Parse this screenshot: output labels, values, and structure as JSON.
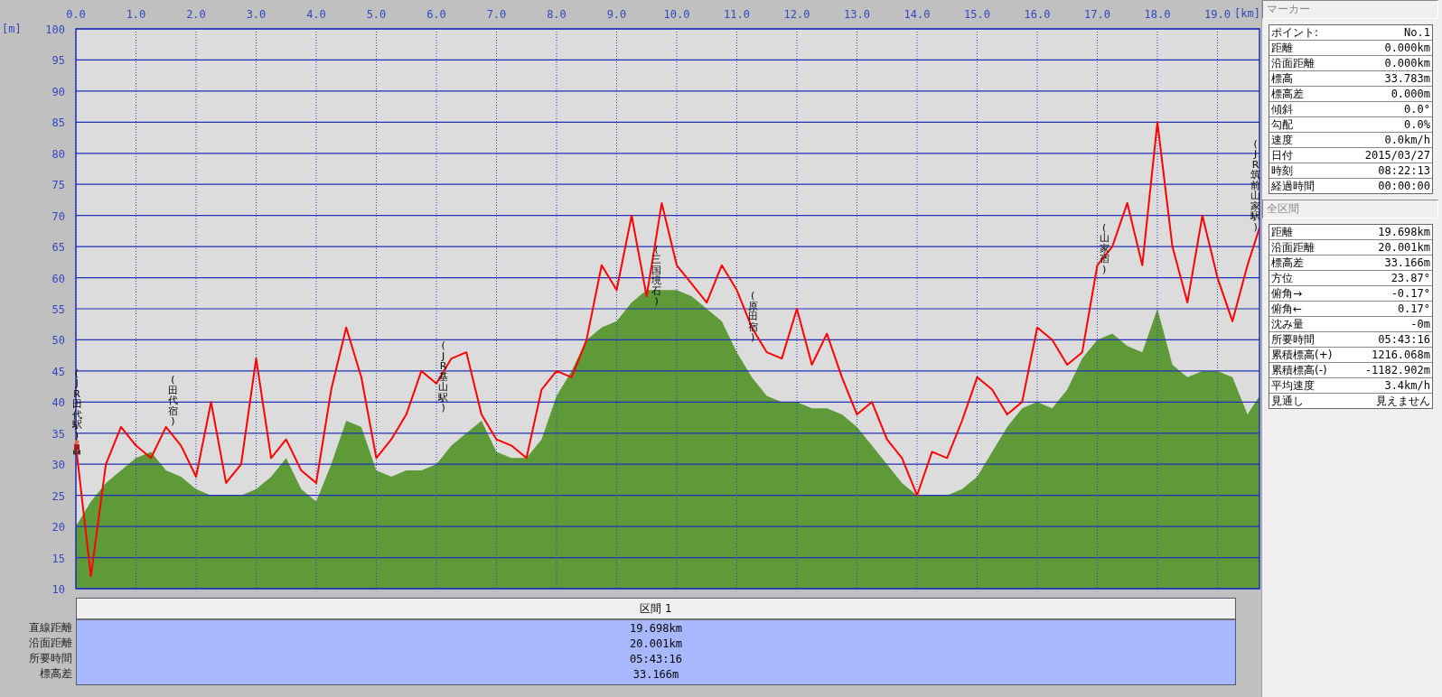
{
  "chart": {
    "chart_data": {
      "type": "area",
      "xlabel": "[km]",
      "ylabel": "[m]",
      "grid": true,
      "xlim": [
        0,
        19.7
      ],
      "ylim": [
        10,
        100
      ],
      "xticks": [
        {
          "value": 0,
          "label": "0.0"
        },
        {
          "value": 1,
          "label": "1.0"
        },
        {
          "value": 2,
          "label": "2.0"
        },
        {
          "value": 3,
          "label": "3.0"
        },
        {
          "value": 4,
          "label": "4.0"
        },
        {
          "value": 5,
          "label": "5.0"
        },
        {
          "value": 6,
          "label": "6.0"
        },
        {
          "value": 7,
          "label": "7.0"
        },
        {
          "value": 8,
          "label": "8.0"
        },
        {
          "value": 9,
          "label": "9.0"
        },
        {
          "value": 10,
          "label": "10.0"
        },
        {
          "value": 11,
          "label": "11.0"
        },
        {
          "value": 12,
          "label": "12.0"
        },
        {
          "value": 13,
          "label": "13.0"
        },
        {
          "value": 14,
          "label": "14.0"
        },
        {
          "value": 15,
          "label": "15.0"
        },
        {
          "value": 16,
          "label": "16.0"
        },
        {
          "value": 17,
          "label": "17.0"
        },
        {
          "value": 18,
          "label": "18.0"
        },
        {
          "value": 19,
          "label": "19.0"
        }
      ],
      "yticks": [
        10,
        15,
        20,
        25,
        30,
        35,
        40,
        45,
        50,
        55,
        60,
        65,
        70,
        75,
        80,
        85,
        90,
        95,
        100
      ],
      "x": [
        0,
        0.25,
        0.5,
        0.75,
        1,
        1.25,
        1.5,
        1.75,
        2,
        2.25,
        2.5,
        2.75,
        3,
        3.25,
        3.5,
        3.75,
        4,
        4.25,
        4.5,
        4.75,
        5,
        5.25,
        5.5,
        5.75,
        6,
        6.25,
        6.5,
        6.75,
        7,
        7.25,
        7.5,
        7.75,
        8,
        8.25,
        8.5,
        8.75,
        9,
        9.25,
        9.5,
        9.75,
        10,
        10.25,
        10.5,
        10.75,
        11,
        11.25,
        11.5,
        11.75,
        12,
        12.25,
        12.5,
        12.75,
        13,
        13.25,
        13.5,
        13.75,
        14,
        14.25,
        14.5,
        14.75,
        15,
        15.25,
        15.5,
        15.75,
        16,
        16.25,
        16.5,
        16.75,
        17,
        17.25,
        17.5,
        17.75,
        18,
        18.25,
        18.5,
        18.75,
        19,
        19.25,
        19.5,
        19.7
      ],
      "series": [
        {
          "type": "area",
          "color": "#5f9a38",
          "values": [
            20,
            24,
            27,
            29,
            31,
            32,
            29,
            28,
            26,
            25,
            25,
            25,
            26,
            28,
            31,
            26,
            24,
            30,
            37,
            36,
            29,
            28,
            29,
            29,
            30,
            33,
            35,
            37,
            32,
            31,
            31,
            34,
            41,
            45,
            50,
            52,
            53,
            56,
            58,
            58,
            58,
            57,
            55,
            53,
            48,
            44,
            41,
            40,
            40,
            39,
            39,
            38,
            36,
            33,
            30,
            27,
            25,
            25,
            25,
            26,
            28,
            32,
            36,
            39,
            40,
            39,
            42,
            47,
            50,
            51,
            49,
            48,
            55,
            46,
            44,
            45,
            45,
            44,
            38,
            41
          ]
        },
        {
          "type": "line",
          "color": "#ff0000",
          "values": [
            33,
            12,
            30,
            36,
            33,
            31,
            36,
            33,
            28,
            40,
            27,
            30,
            47,
            31,
            34,
            29,
            27,
            42,
            52,
            44,
            31,
            34,
            38,
            45,
            43,
            47,
            48,
            38,
            34,
            33,
            31,
            42,
            45,
            44,
            50,
            62,
            58,
            70,
            57,
            72,
            62,
            59,
            56,
            62,
            58,
            52,
            48,
            47,
            55,
            46,
            51,
            44,
            38,
            40,
            34,
            31,
            25,
            32,
            31,
            37,
            44,
            42,
            38,
            40,
            52,
            50,
            46,
            48,
            62,
            65,
            72,
            62,
            85,
            65,
            56,
            70,
            60,
            53,
            62,
            68
          ]
        }
      ],
      "annotations": [
        "(JR田代駅)",
        "(田代宿)",
        "(JR基山駅)",
        "(三国境石)",
        "(原田宿)",
        "(山家宿)",
        "(JR筑前山家駅)"
      ]
    }
  },
  "section_table": {
    "header": "区間 1",
    "rows": [
      {
        "label": "直線距離",
        "value": "19.698km"
      },
      {
        "label": "沿面距離",
        "value": "20.001km"
      },
      {
        "label": "所要時間",
        "value": "05:43:16"
      },
      {
        "label": "標高差",
        "value": "33.166m"
      }
    ]
  },
  "marker_panel": {
    "title": "マーカー",
    "rows": [
      {
        "label": "ポイント:",
        "value": "No.1"
      },
      {
        "label": "距離",
        "value": "0.000km"
      },
      {
        "label": "沿面距離",
        "value": "0.000km"
      },
      {
        "label": "標高",
        "value": "33.783m"
      },
      {
        "label": "標高差",
        "value": "0.000m"
      },
      {
        "label": "傾斜",
        "value": "0.0°"
      },
      {
        "label": "勾配",
        "value": "0.0%"
      },
      {
        "label": "速度",
        "value": "0.0km/h"
      },
      {
        "label": "日付",
        "value": "2015/03/27"
      },
      {
        "label": "時刻",
        "value": "08:22:13"
      },
      {
        "label": "経過時間",
        "value": "00:00:00"
      }
    ]
  },
  "total_panel": {
    "title": "全区間",
    "rows": [
      {
        "label": "距離",
        "value": "19.698km"
      },
      {
        "label": "沿面距離",
        "value": "20.001km"
      },
      {
        "label": "標高差",
        "value": "33.166m"
      },
      {
        "label": "方位",
        "value": "23.87°"
      },
      {
        "label": "俯角→",
        "value": "-0.17°"
      },
      {
        "label": "俯角←",
        "value": "0.17°"
      },
      {
        "label": "沈み量",
        "value": "-0m"
      },
      {
        "label": "所要時間",
        "value": "05:43:16"
      },
      {
        "label": "累積標高(+)",
        "value": "1216.068m"
      },
      {
        "label": "累積標高(-)",
        "value": "-1182.902m"
      },
      {
        "label": "平均速度",
        "value": "3.4km/h"
      },
      {
        "label": "見通し",
        "value": "見えません"
      }
    ]
  }
}
